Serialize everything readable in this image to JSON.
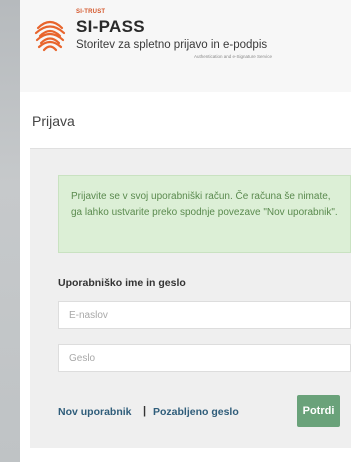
{
  "header": {
    "brand_small": "SI-TRUST",
    "brand_title": "SI-PASS",
    "brand_subtitle": "Storitev za spletno prijavo in e-podpis",
    "brand_tagline": "Authentication and e-Signature Service",
    "logo_icon": "fingerprint-icon",
    "logo_color": "#e8642c"
  },
  "page": {
    "title": "Prijava"
  },
  "info": {
    "message": "Prijavite se v svoj uporabniški račun. Če računa še nimate, ga lahko ustvarite preko spodnje povezave \"Nov uporabnik\"."
  },
  "form": {
    "section_label": "Uporabniško ime in geslo",
    "email_placeholder": "E-naslov",
    "password_placeholder": "Geslo",
    "new_user_link": "Nov uporabnik",
    "separator": "|",
    "forgot_link": "Pozabljeno geslo",
    "submit_label": "Potrdi",
    "submit_color": "#6aa27a"
  }
}
